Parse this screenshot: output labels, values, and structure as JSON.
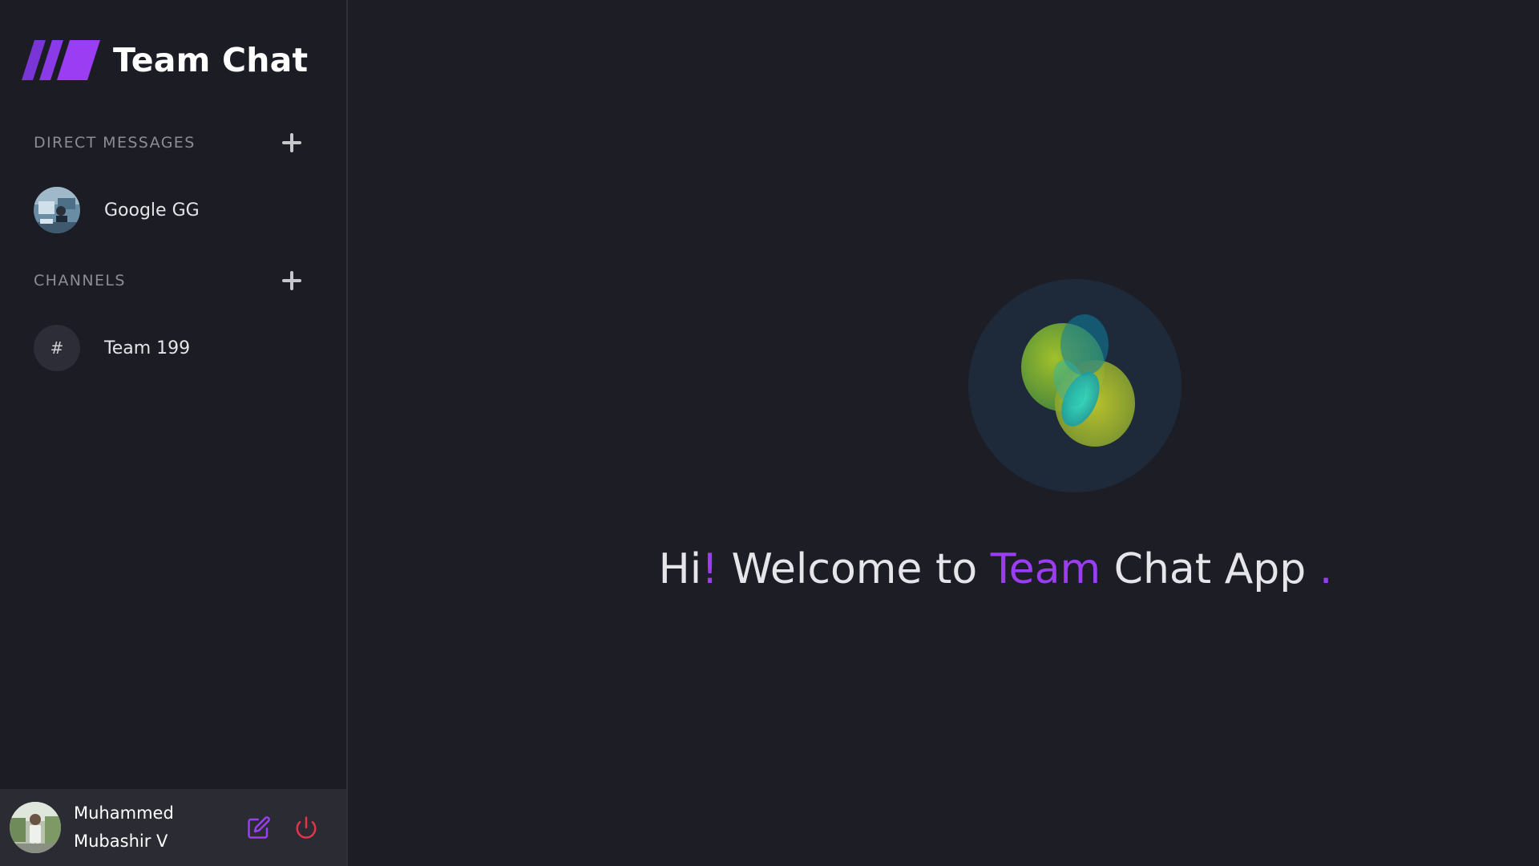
{
  "app": {
    "title": "Team Chat",
    "accent_color": "#9b3df2",
    "danger_color": "#e0364b"
  },
  "sidebar": {
    "direct_messages": {
      "title": "DIRECT MESSAGES",
      "items": [
        {
          "label": "Google GG",
          "avatar": "user-photo"
        }
      ]
    },
    "channels": {
      "title": "CHANNELS",
      "items": [
        {
          "label": "Team 199",
          "icon": "#"
        }
      ]
    }
  },
  "profile": {
    "name_line1": "Muhammed",
    "name_line2": "Mubashir V",
    "edit_icon": "edit-icon",
    "logout_icon": "power-icon"
  },
  "main": {
    "welcome": {
      "part1": "Hi",
      "exclaim": "!",
      "part2": " Welcome to ",
      "accent_word": "Team",
      "part3": " Chat App ",
      "dot": "."
    }
  }
}
